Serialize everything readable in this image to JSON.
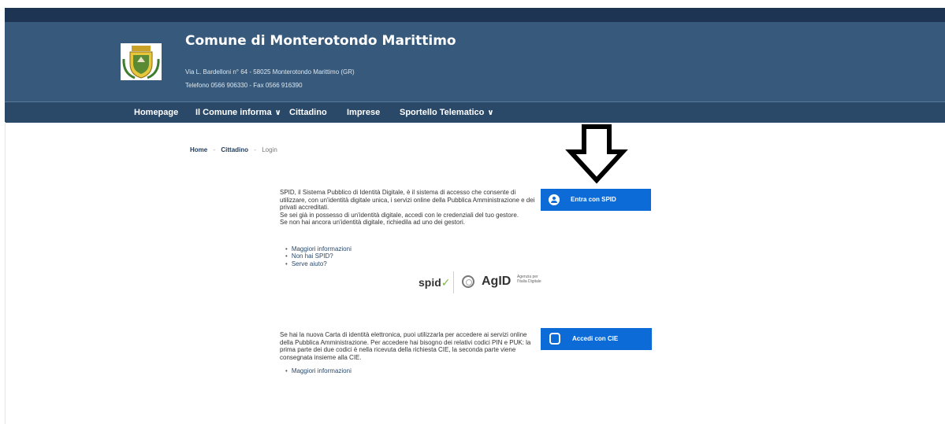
{
  "header": {
    "title": "Comune di Monterotondo Marittimo",
    "address": "Via L. Bardelloni n° 64 - 58025 Monterotondo Marittimo (GR)",
    "phone": "Telefono 0566 906330 - Fax 0566 916390"
  },
  "nav": {
    "homepage": "Homepage",
    "comune": "Il Comune informa",
    "cittadino": "Cittadino",
    "imprese": "Imprese",
    "sportello": "Sportello Telematico",
    "chevron": "∨"
  },
  "breadcrumb": {
    "home": "Home",
    "cittadino": "Cittadino",
    "current": "Login",
    "separator": "-"
  },
  "spid": {
    "para1": "SPID, il Sistema Pubblico di Identità Digitale, è il sistema di accesso che consente di utilizzare, con un'identità digitale unica, i servizi online della Pubblica Amministrazione e dei privati accreditati.",
    "para2": "Se sei già in possesso di un'identità digitale, accedi con le credenziali del tuo gestore.",
    "para3": "Se non hai ancora un'identità digitale, richiedila ad uno dei gestori.",
    "links": [
      "Maggiori informazioni",
      "Non hai SPID?",
      "Serve aiuto?"
    ],
    "button": "Entra con SPID",
    "logo_text": "spid",
    "logo_check": "✓",
    "agid": "AgID",
    "agid_sub1": "Agenzia per",
    "agid_sub2": "l'Italia Digitale"
  },
  "cie": {
    "para": "Se hai la nuova Carta di identità elettronica, puoi utilizzarla per accedere ai servizi online della Pubblica Amministrazione. Per accedere hai bisogno dei relativi codici PIN e PUK: la prima parte dei due codici è nella ricevuta della richiesta CIE, la seconda parte viene consegnata insieme alla CIE.",
    "link": "Maggiori informazioni",
    "button": "Accedi con CIE"
  },
  "icons": {
    "logo": "coat-of-arms-icon",
    "arrow": "down-arrow-icon",
    "spid_user": "user-icon",
    "cie_card": "id-card-icon"
  },
  "colors": {
    "header_bg": "#375a7c",
    "top_strip": "#1d3553",
    "nav_bg": "#2a4868",
    "button": "#0c6bd7"
  }
}
